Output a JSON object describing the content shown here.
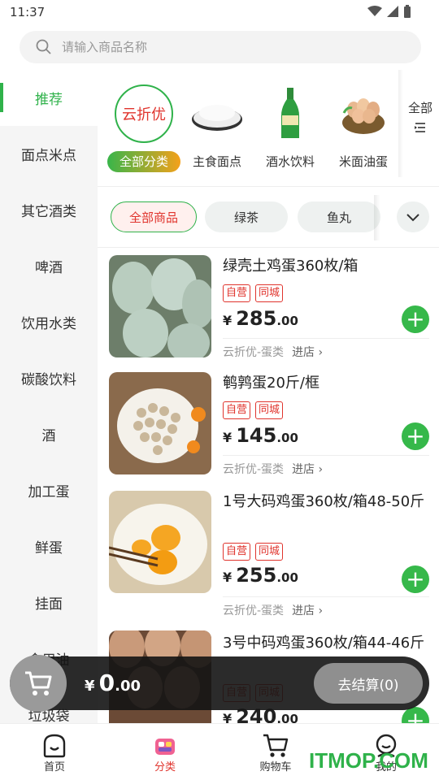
{
  "status": {
    "time": "11:37"
  },
  "search": {
    "placeholder": "请输入商品名称"
  },
  "sidebar": {
    "items": [
      {
        "label": "推荐"
      },
      {
        "label": "面点米点"
      },
      {
        "label": "其它酒类"
      },
      {
        "label": "啤酒"
      },
      {
        "label": "饮用水类"
      },
      {
        "label": "碳酸饮料"
      },
      {
        "label": "酒"
      },
      {
        "label": "加工蛋"
      },
      {
        "label": "鲜蛋"
      },
      {
        "label": "挂面"
      },
      {
        "label": "食用油"
      },
      {
        "label": "垃圾袋"
      }
    ]
  },
  "categories": {
    "logo_text": "云折优",
    "items": [
      {
        "label": "全部分类"
      },
      {
        "label": "主食面点"
      },
      {
        "label": "酒水饮料"
      },
      {
        "label": "米面油蛋"
      }
    ],
    "all_label": "全部"
  },
  "chips": [
    {
      "label": "全部商品"
    },
    {
      "label": "绿茶"
    },
    {
      "label": "鱼丸"
    }
  ],
  "products": [
    {
      "name": "绿壳土鸡蛋360枚/箱",
      "tags": [
        "自营",
        "同城"
      ],
      "yen": "¥",
      "price_int": "285",
      "price_dec": ".00",
      "shop": "云折优-蛋类",
      "enter": "进店 ›"
    },
    {
      "name": "鹌鹑蛋20斤/框",
      "tags": [
        "自营",
        "同城"
      ],
      "yen": "¥",
      "price_int": "145",
      "price_dec": ".00",
      "shop": "云折优-蛋类",
      "enter": "进店 ›"
    },
    {
      "name": "1号大码鸡蛋360枚/箱48-50斤",
      "tags": [
        "自营",
        "同城"
      ],
      "yen": "¥",
      "price_int": "255",
      "price_dec": ".00",
      "shop": "云折优-蛋类",
      "enter": "进店 ›"
    },
    {
      "name": "3号中码鸡蛋360枚/箱44-46斤",
      "tags": [
        "自营",
        "同城"
      ],
      "yen": "¥",
      "price_int": "240",
      "price_dec": ".00"
    }
  ],
  "cart": {
    "yen": "¥",
    "int": "0",
    "dec": ".00",
    "checkout": "去结算(0)"
  },
  "tabs": [
    {
      "label": "首页"
    },
    {
      "label": "分类"
    },
    {
      "label": "购物车"
    },
    {
      "label": "我的"
    }
  ],
  "watermark": "ITMOP.COM",
  "colors": {
    "accent": "#2fb24a",
    "price_red": "#e0342d"
  }
}
